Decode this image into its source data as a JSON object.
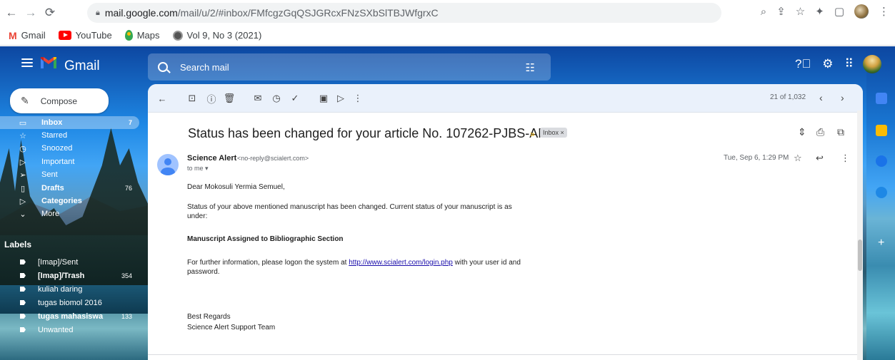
{
  "browser": {
    "url_host": "mail.google.com",
    "url_path": "/mail/u/2/#inbox/FMfcgzGqQSJGRcxFNzSXbSlTBJWfgrxC",
    "bookmarks": [
      {
        "label": "Gmail"
      },
      {
        "label": "YouTube"
      },
      {
        "label": "Maps"
      },
      {
        "label": "Vol 9, No 3 (2021)"
      }
    ]
  },
  "header": {
    "app_name": "Gmail",
    "search_placeholder": "Search mail"
  },
  "sidebar": {
    "compose_label": "Compose",
    "items": [
      {
        "label": "Inbox",
        "count": "7"
      },
      {
        "label": "Starred",
        "count": ""
      },
      {
        "label": "Snoozed",
        "count": ""
      },
      {
        "label": "Important",
        "count": ""
      },
      {
        "label": "Sent",
        "count": ""
      },
      {
        "label": "Drafts",
        "count": "76"
      },
      {
        "label": "Categories",
        "count": ""
      },
      {
        "label": "More",
        "count": ""
      }
    ],
    "labels_title": "Labels",
    "labels": [
      {
        "label": "[Imap]/Sent",
        "count": ""
      },
      {
        "label": "[Imap]/Trash",
        "count": "354"
      },
      {
        "label": "kuliah daring",
        "count": ""
      },
      {
        "label": "tugas biomol 2016",
        "count": ""
      },
      {
        "label": "tugas mahasiswa",
        "count": "133"
      },
      {
        "label": "Unwanted",
        "count": ""
      }
    ]
  },
  "toolbar": {
    "counter": "21 of 1,032"
  },
  "email": {
    "subject": "Status has been changed for your article No. 107262-PJBS-ANSI",
    "chip": "Inbox ×",
    "from_name": "Science Alert",
    "from_email": "<no-reply@scialert.com>",
    "to": "to me ▾",
    "date": "Tue, Sep 6, 1:29 PM",
    "greeting": "Dear Mokosuli Yermia Semuel,",
    "para1": "Status of your above mentioned manuscript has been changed. Current status of your manuscript is as under:",
    "status": "Manuscript Assigned to Bibliographic Section",
    "para2_pre": "For further information, please logon the system at ",
    "link": "http://www.scialert.com/login.php",
    "para2_post": " with your user id and password.",
    "regards": "Best Regards",
    "signature": "Science Alert Support Team"
  }
}
